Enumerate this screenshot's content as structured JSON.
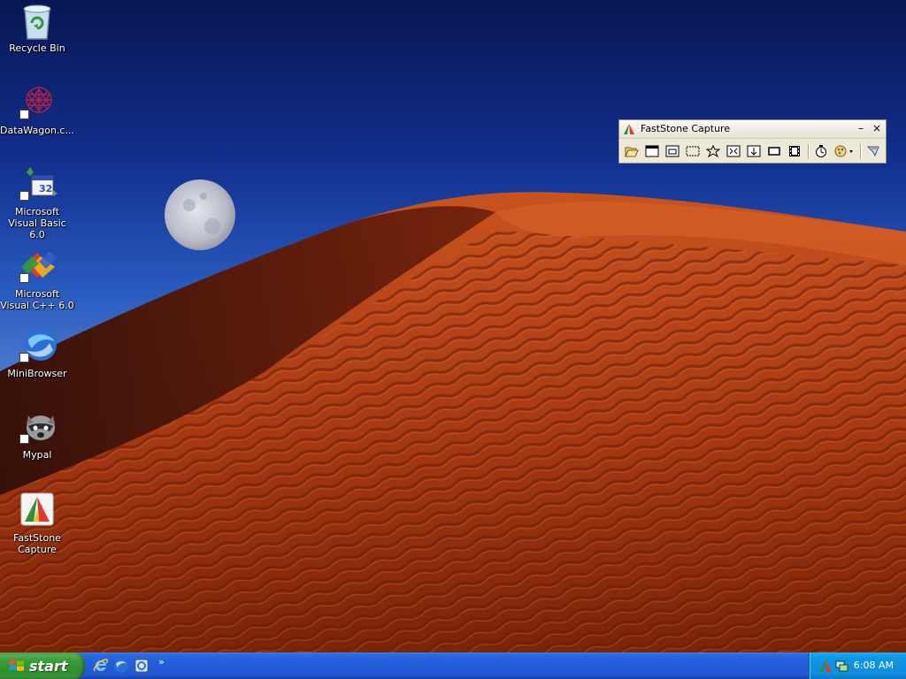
{
  "desktop": {
    "icons": [
      {
        "label": "Recycle Bin",
        "icon": "recycle-bin-icon"
      },
      {
        "label": "DataWagon.c...",
        "icon": "datawagon-icon"
      },
      {
        "label": "Microsoft Visual Basic 6.0",
        "icon": "visual-basic-icon"
      },
      {
        "label": "Microsoft Visual C++ 6.0",
        "icon": "visual-cpp-icon"
      },
      {
        "label": "MiniBrowser",
        "icon": "minibrowser-icon"
      },
      {
        "label": "Mypal",
        "icon": "mypal-icon"
      },
      {
        "label": "FastStone Capture",
        "icon": "faststone-capture-icon"
      }
    ]
  },
  "faststone": {
    "title": "FastStone Capture",
    "minimize": "–",
    "close": "×",
    "tools": [
      "open-icon",
      "capture-active-window-icon",
      "capture-window-object-icon",
      "capture-rectangle-icon",
      "capture-freehand-icon",
      "capture-fullscreen-icon",
      "capture-scrolling-icon",
      "capture-fixed-region-icon",
      "screen-recorder-icon",
      "delay-timer-icon",
      "output-options-icon",
      "settings-icon"
    ]
  },
  "taskbar": {
    "start_label": "start",
    "quicklaunch": [
      "internet-explorer-icon",
      "minibrowser-icon",
      "mypal-icon"
    ],
    "overflow": "»",
    "tray": {
      "icons": [
        "faststone-tray-icon",
        "network-tray-icon"
      ],
      "clock": "6:08 AM"
    }
  },
  "colors": {
    "taskbar_blue": "#245edb",
    "start_green": "#3c9d3c",
    "tray_blue": "#0f96e4",
    "dune_red": "#b8401a"
  }
}
